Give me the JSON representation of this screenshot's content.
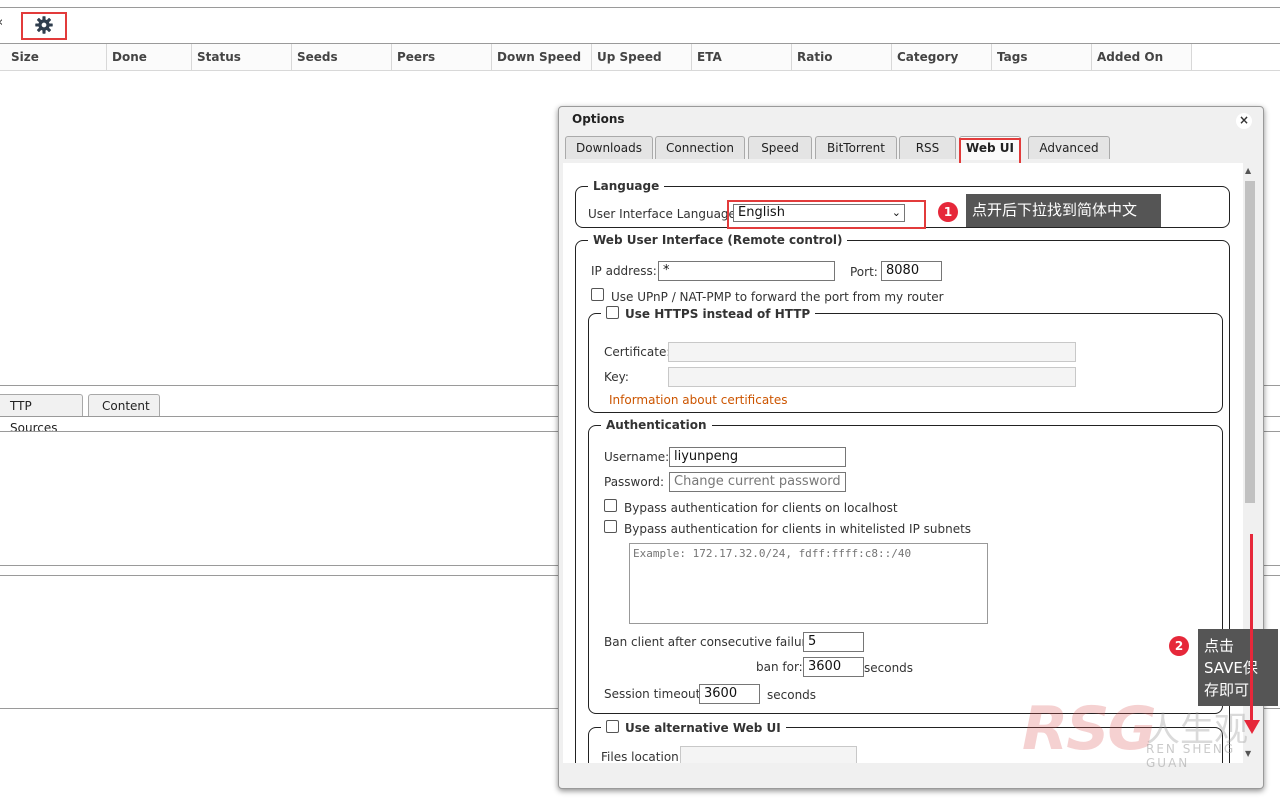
{
  "toolbar": {
    "left_edge_glyph": "‹",
    "settings_icon": "gear-icon"
  },
  "table": {
    "columns": [
      "Size",
      "Done",
      "Status",
      "Seeds",
      "Peers",
      "Down Speed",
      "Up Speed",
      "ETA",
      "Ratio",
      "Category",
      "Tags",
      "Added On"
    ]
  },
  "lower_tabs": [
    "TTP Sources",
    "Content"
  ],
  "dialog": {
    "title": "Options",
    "close": "×",
    "tabs": [
      "Downloads",
      "Connection",
      "Speed",
      "BitTorrent",
      "RSS",
      "Web UI",
      "Advanced"
    ],
    "active_tab": "Web UI",
    "language": {
      "legend": "Language",
      "label": "User Interface Language:",
      "value": "English"
    },
    "webui": {
      "legend": "Web User Interface (Remote control)",
      "ip_label": "IP address:",
      "ip_value": "*",
      "port_label": "Port:",
      "port_value": "8080",
      "upnp_label": "Use UPnP / NAT-PMP to forward the port from my router"
    },
    "https": {
      "legend": "Use HTTPS instead of HTTP",
      "cert_label": "Certificate:",
      "key_label": "Key:",
      "info_link": "Information about certificates"
    },
    "auth": {
      "legend": "Authentication",
      "username_label": "Username:",
      "username_value": "liyunpeng",
      "password_label": "Password:",
      "password_placeholder": "Change current password",
      "bypass_localhost": "Bypass authentication for clients on localhost",
      "bypass_whitelist": "Bypass authentication for clients in whitelisted IP subnets",
      "subnet_placeholder": "Example: 172.17.32.0/24, fdff:ffff:c8::/40",
      "ban_label": "Ban client after consecutive failures:",
      "ban_value": "5",
      "ban_for_label": "ban for:",
      "ban_for_value": "3600",
      "ban_for_unit": "seconds",
      "session_label": "Session timeout:",
      "session_value": "3600",
      "session_unit": "seconds"
    },
    "alt_webui": {
      "legend": "Use alternative Web UI",
      "files_label": "Files location:"
    }
  },
  "annotations": {
    "step1_badge": "1",
    "step1_text": "点开后下拉找到简体中文",
    "step2_badge": "2",
    "step2_text": "点击SAVE保存即可",
    "highlight_color": "#e23b3b"
  },
  "watermark": {
    "logo": "RSG",
    "cn": "人生观",
    "sub": "REN SHENG GUAN"
  }
}
